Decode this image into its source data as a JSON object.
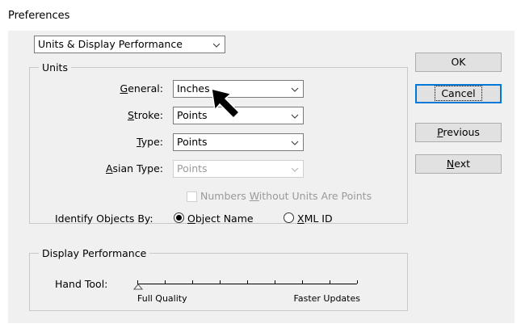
{
  "window": {
    "title": "Preferences"
  },
  "section_select": {
    "value": "Units & Display Performance"
  },
  "units": {
    "legend": "Units",
    "general": {
      "label_u": "G",
      "label_rest": "eneral:",
      "value": "Inches"
    },
    "stroke": {
      "label_u": "S",
      "label_rest": "troke:",
      "value": "Points"
    },
    "type": {
      "label_u": "T",
      "label_rest": "ype:",
      "value": "Points"
    },
    "asian_type": {
      "label_u": "A",
      "label_rest": "sian Type:",
      "value": "Points"
    },
    "numbers_checkbox": {
      "pre": "Numbers ",
      "u": "W",
      "post": "ithout Units Are Points",
      "checked": false
    },
    "identify": {
      "label": "Identify Objects By:",
      "object_name": {
        "u": "O",
        "rest": "bject Name",
        "selected": true
      },
      "xml_id": {
        "u": "X",
        "rest": "ML ID",
        "selected": false
      }
    }
  },
  "display": {
    "legend": "Display Performance",
    "hand_tool_label": "Hand Tool:",
    "left_label": "Full Quality",
    "right_label": "Faster Updates",
    "slider_level": 0
  },
  "buttons": {
    "ok": "OK",
    "cancel": "Cancel",
    "previous_u": "P",
    "previous_rest": "revious",
    "next_u": "N",
    "next_rest": "ext"
  }
}
